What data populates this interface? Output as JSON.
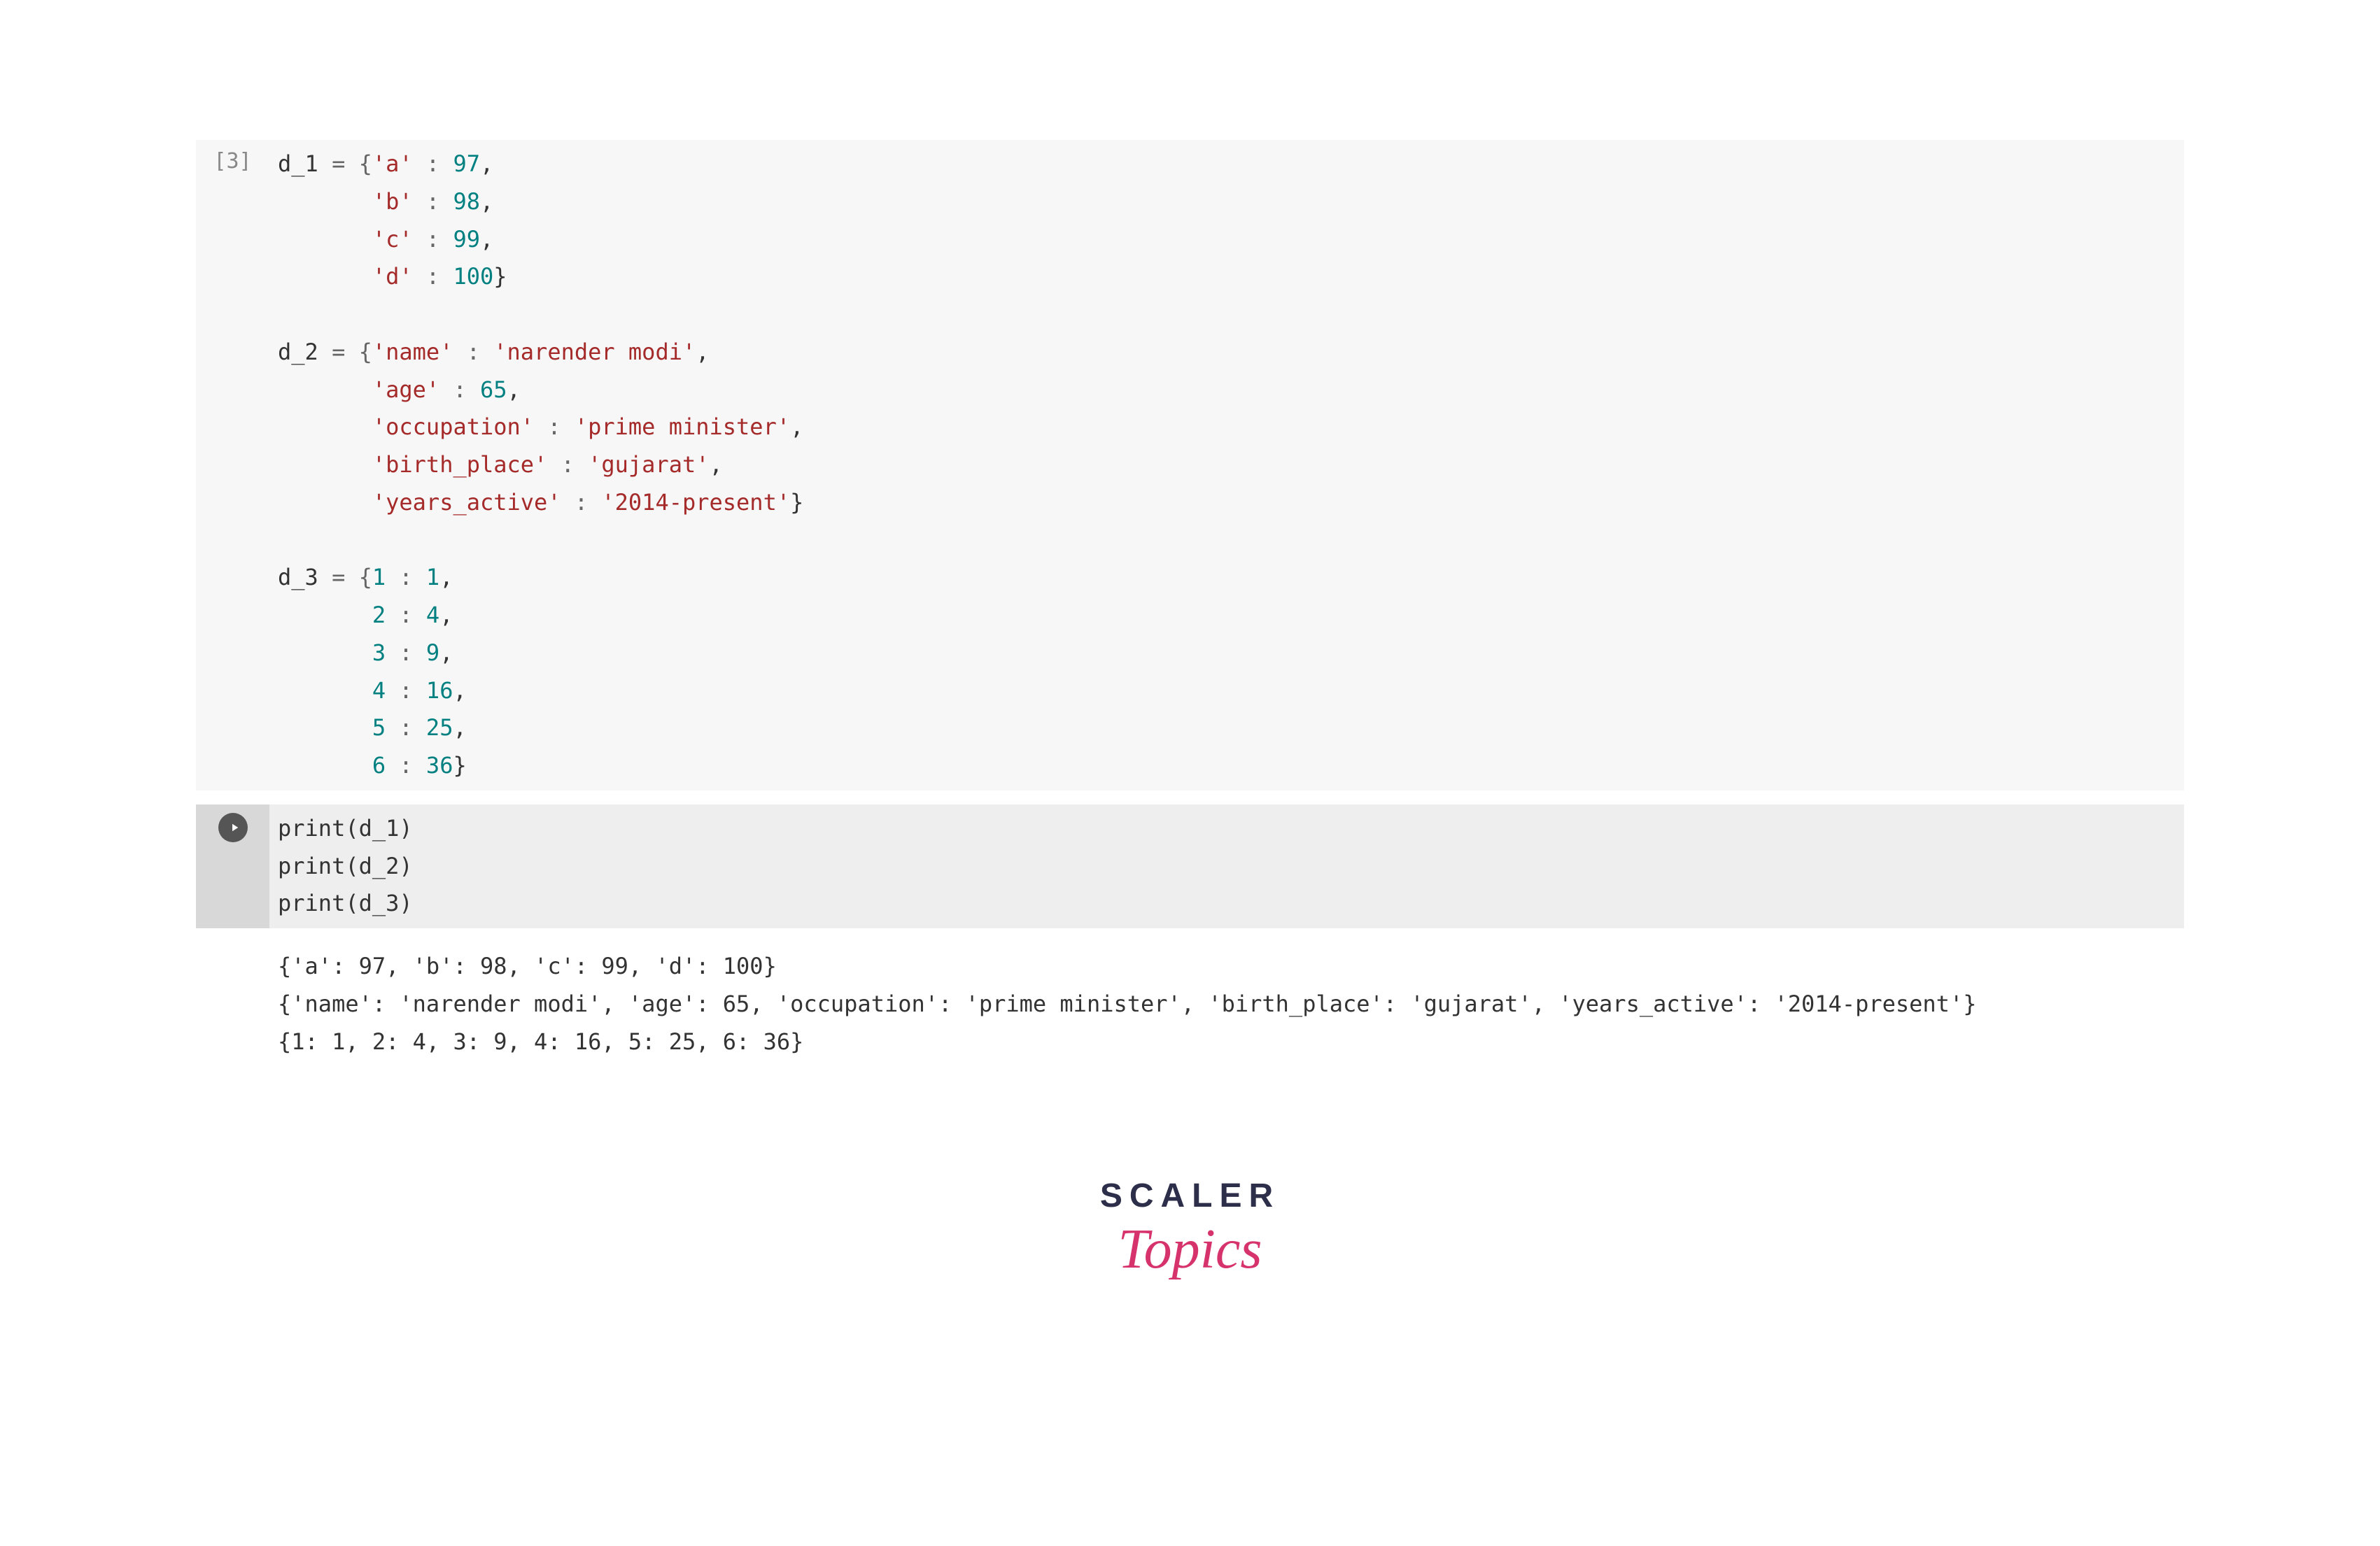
{
  "cell1": {
    "exec_label": "[3]",
    "code": {
      "line1_var": "d_1",
      "line1_eq": " = {",
      "l1_k": "'a'",
      "l1_c": " : ",
      "l1_v": "97",
      "l1_e": ",",
      "l2_k": "'b'",
      "l2_v": "98",
      "l3_k": "'c'",
      "l3_v": "99",
      "l4_k": "'d'",
      "l4_v": "100",
      "l4_e": "}",
      "d2_var": "d_2",
      "d2_k1": "'name'",
      "d2_v1": "'narender modi'",
      "d2_k2": "'age'",
      "d2_v2": "65",
      "d2_k3": "'occupation'",
      "d2_v3": "'prime minister'",
      "d2_k4": "'birth_place'",
      "d2_v4": "'gujarat'",
      "d2_k5": "'years_active'",
      "d2_v5": "'2014-present'",
      "d3_var": "d_3",
      "d3_k1": "1",
      "d3_v1": "1",
      "d3_k2": "2",
      "d3_v2": "4",
      "d3_k3": "3",
      "d3_v3": "9",
      "d3_k4": "4",
      "d3_v4": "16",
      "d3_k5": "5",
      "d3_v5": "25",
      "d3_k6": "6",
      "d3_v6": "36"
    }
  },
  "cell2": {
    "l1_func": "print",
    "l1_arg": "d_1",
    "l2_func": "print",
    "l2_arg": "d_2",
    "l3_func": "print",
    "l3_arg": "d_3"
  },
  "output": {
    "line1": "{'a': 97, 'b': 98, 'c': 99, 'd': 100}",
    "line2": "{'name': 'narender modi', 'age': 65, 'occupation': 'prime minister', 'birth_place': 'gujarat', 'years_active': '2014-present'}",
    "line3": "{1: 1, 2: 4, 3: 9, 4: 16, 5: 25, 6: 36}"
  },
  "logo": {
    "scaler": "SCALER",
    "topics": "Topics"
  }
}
